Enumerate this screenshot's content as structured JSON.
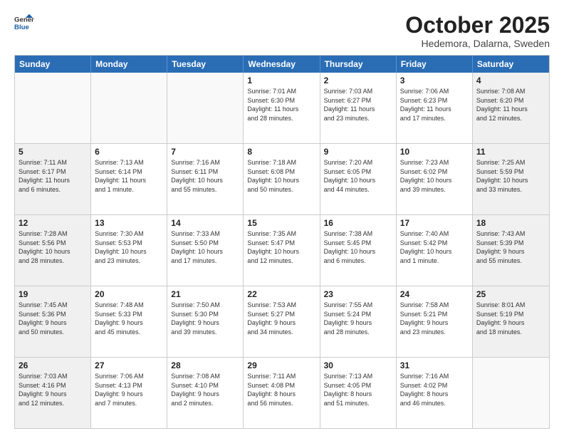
{
  "header": {
    "logo": {
      "line1": "General",
      "line2": "Blue"
    },
    "title": "October 2025",
    "subtitle": "Hedemora, Dalarna, Sweden"
  },
  "weekdays": [
    "Sunday",
    "Monday",
    "Tuesday",
    "Wednesday",
    "Thursday",
    "Friday",
    "Saturday"
  ],
  "rows": [
    [
      {
        "day": "",
        "info": "",
        "empty": true
      },
      {
        "day": "",
        "info": "",
        "empty": true
      },
      {
        "day": "",
        "info": "",
        "empty": true
      },
      {
        "day": "1",
        "info": "Sunrise: 7:01 AM\nSunset: 6:30 PM\nDaylight: 11 hours\nand 28 minutes."
      },
      {
        "day": "2",
        "info": "Sunrise: 7:03 AM\nSunset: 6:27 PM\nDaylight: 11 hours\nand 23 minutes."
      },
      {
        "day": "3",
        "info": "Sunrise: 7:06 AM\nSunset: 6:23 PM\nDaylight: 11 hours\nand 17 minutes."
      },
      {
        "day": "4",
        "info": "Sunrise: 7:08 AM\nSunset: 6:20 PM\nDaylight: 11 hours\nand 12 minutes.",
        "shaded": true
      }
    ],
    [
      {
        "day": "5",
        "info": "Sunrise: 7:11 AM\nSunset: 6:17 PM\nDaylight: 11 hours\nand 6 minutes.",
        "shaded": true
      },
      {
        "day": "6",
        "info": "Sunrise: 7:13 AM\nSunset: 6:14 PM\nDaylight: 11 hours\nand 1 minute."
      },
      {
        "day": "7",
        "info": "Sunrise: 7:16 AM\nSunset: 6:11 PM\nDaylight: 10 hours\nand 55 minutes."
      },
      {
        "day": "8",
        "info": "Sunrise: 7:18 AM\nSunset: 6:08 PM\nDaylight: 10 hours\nand 50 minutes."
      },
      {
        "day": "9",
        "info": "Sunrise: 7:20 AM\nSunset: 6:05 PM\nDaylight: 10 hours\nand 44 minutes."
      },
      {
        "day": "10",
        "info": "Sunrise: 7:23 AM\nSunset: 6:02 PM\nDaylight: 10 hours\nand 39 minutes."
      },
      {
        "day": "11",
        "info": "Sunrise: 7:25 AM\nSunset: 5:59 PM\nDaylight: 10 hours\nand 33 minutes.",
        "shaded": true
      }
    ],
    [
      {
        "day": "12",
        "info": "Sunrise: 7:28 AM\nSunset: 5:56 PM\nDaylight: 10 hours\nand 28 minutes.",
        "shaded": true
      },
      {
        "day": "13",
        "info": "Sunrise: 7:30 AM\nSunset: 5:53 PM\nDaylight: 10 hours\nand 23 minutes."
      },
      {
        "day": "14",
        "info": "Sunrise: 7:33 AM\nSunset: 5:50 PM\nDaylight: 10 hours\nand 17 minutes."
      },
      {
        "day": "15",
        "info": "Sunrise: 7:35 AM\nSunset: 5:47 PM\nDaylight: 10 hours\nand 12 minutes."
      },
      {
        "day": "16",
        "info": "Sunrise: 7:38 AM\nSunset: 5:45 PM\nDaylight: 10 hours\nand 6 minutes."
      },
      {
        "day": "17",
        "info": "Sunrise: 7:40 AM\nSunset: 5:42 PM\nDaylight: 10 hours\nand 1 minute."
      },
      {
        "day": "18",
        "info": "Sunrise: 7:43 AM\nSunset: 5:39 PM\nDaylight: 9 hours\nand 55 minutes.",
        "shaded": true
      }
    ],
    [
      {
        "day": "19",
        "info": "Sunrise: 7:45 AM\nSunset: 5:36 PM\nDaylight: 9 hours\nand 50 minutes.",
        "shaded": true
      },
      {
        "day": "20",
        "info": "Sunrise: 7:48 AM\nSunset: 5:33 PM\nDaylight: 9 hours\nand 45 minutes."
      },
      {
        "day": "21",
        "info": "Sunrise: 7:50 AM\nSunset: 5:30 PM\nDaylight: 9 hours\nand 39 minutes."
      },
      {
        "day": "22",
        "info": "Sunrise: 7:53 AM\nSunset: 5:27 PM\nDaylight: 9 hours\nand 34 minutes."
      },
      {
        "day": "23",
        "info": "Sunrise: 7:55 AM\nSunset: 5:24 PM\nDaylight: 9 hours\nand 28 minutes."
      },
      {
        "day": "24",
        "info": "Sunrise: 7:58 AM\nSunset: 5:21 PM\nDaylight: 9 hours\nand 23 minutes."
      },
      {
        "day": "25",
        "info": "Sunrise: 8:01 AM\nSunset: 5:19 PM\nDaylight: 9 hours\nand 18 minutes.",
        "shaded": true
      }
    ],
    [
      {
        "day": "26",
        "info": "Sunrise: 7:03 AM\nSunset: 4:16 PM\nDaylight: 9 hours\nand 12 minutes.",
        "shaded": true
      },
      {
        "day": "27",
        "info": "Sunrise: 7:06 AM\nSunset: 4:13 PM\nDaylight: 9 hours\nand 7 minutes."
      },
      {
        "day": "28",
        "info": "Sunrise: 7:08 AM\nSunset: 4:10 PM\nDaylight: 9 hours\nand 2 minutes."
      },
      {
        "day": "29",
        "info": "Sunrise: 7:11 AM\nSunset: 4:08 PM\nDaylight: 8 hours\nand 56 minutes."
      },
      {
        "day": "30",
        "info": "Sunrise: 7:13 AM\nSunset: 4:05 PM\nDaylight: 8 hours\nand 51 minutes."
      },
      {
        "day": "31",
        "info": "Sunrise: 7:16 AM\nSunset: 4:02 PM\nDaylight: 8 hours\nand 46 minutes."
      },
      {
        "day": "",
        "info": "",
        "empty": true,
        "shaded": true
      }
    ]
  ]
}
